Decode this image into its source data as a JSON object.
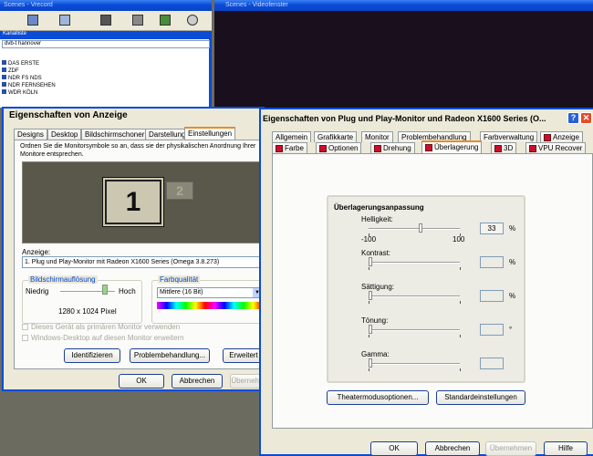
{
  "bg_window_left": {
    "title": "Scenes - Vrecord",
    "channel_label": "Kanalliste",
    "channel_select": "dvb-t hannover",
    "channels": [
      "DAS ERSTE",
      "ZDF",
      "NDR FS NDS",
      "NDR FERNSEHEN",
      "WDR KÖLN"
    ]
  },
  "bg_window_right": {
    "title": "Scenes - Videofenster"
  },
  "display_props": {
    "title": "Eigenschaften von Anzeige",
    "tabs": [
      "Designs",
      "Desktop",
      "Bildschirmschoner",
      "Darstellung",
      "Einstellungen"
    ],
    "instructions": "Ordnen Sie die Monitorsymbole so an, dass sie der physikalischen Anordnung Ihrer Monitore entsprechen.",
    "monitor1": "1",
    "monitor2": "2",
    "anzeige_label": "Anzeige:",
    "anzeige_value": "1. Plug und Play-Monitor mit Radeon X1600 Series (Omega 3.8.273)",
    "res_group": "Bildschirmauflösung",
    "res_low": "Niedrig",
    "res_high": "Hoch",
    "res_value": "1280 x 1024 Pixel",
    "color_group": "Farbqualität",
    "color_value": "Mittlere (16 Bit)",
    "check1": "Dieses Gerät als primären Monitor verwenden",
    "check2": "Windows-Desktop auf diesen Monitor erweitern",
    "btn_identify": "Identifizieren",
    "btn_trouble": "Problembehandlung...",
    "btn_advanced": "Erweitert",
    "btn_ok": "OK",
    "btn_cancel": "Abbrechen",
    "btn_apply": "Übernehm"
  },
  "pnp_props": {
    "title": "Eigenschaften von Plug und Play-Monitor und Radeon X1600 Series (O...",
    "tabs_row1": [
      "Allgemein",
      "Grafikkarte",
      "Monitor",
      "Problembehandlung",
      "Farbverwaltung",
      "Anzeige"
    ],
    "tabs_row2": [
      "Farbe",
      "Optionen",
      "Drehung",
      "Überlagerung",
      "3D",
      "VPU Recover"
    ],
    "group_title": "Überlagerungsanpassung",
    "sliders": [
      {
        "label": "Helligkeit:",
        "value": "33",
        "unit": "%",
        "min": "-100",
        "max": "100",
        "level": 0.58,
        "enabled": true
      },
      {
        "label": "Kontrast:",
        "value": "",
        "unit": "%",
        "level": 0.0,
        "enabled": false
      },
      {
        "label": "Sättigung:",
        "value": "",
        "unit": "%",
        "level": 0.0,
        "enabled": false
      },
      {
        "label": "Tönung:",
        "value": "",
        "unit": "°",
        "level": 0.0,
        "enabled": false
      },
      {
        "label": "Gamma:",
        "value": "",
        "unit": "",
        "level": 0.0,
        "enabled": false
      }
    ],
    "btn_theater": "Theatermodusoptionen...",
    "btn_defaults": "Standardeinstellungen",
    "btn_ok": "OK",
    "btn_cancel": "Abbrechen",
    "btn_apply": "Übernehmen",
    "btn_help": "Hilfe"
  },
  "colors": {
    "xp_blue": "#0a4bd8",
    "dialog_bg": "#ece9d8",
    "ati_red": "#c8102e"
  }
}
